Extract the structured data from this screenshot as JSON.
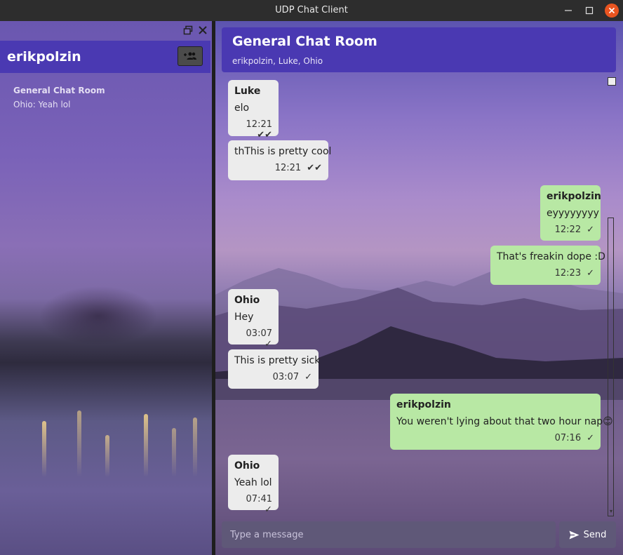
{
  "window": {
    "title": "UDP Chat Client"
  },
  "sidebar": {
    "username": "erikpolzin",
    "conversations": [
      {
        "name": "General Chat Room",
        "preview": "Ohio: Yeah lol"
      }
    ]
  },
  "chat": {
    "room_title": "General Chat Room",
    "members": "erikpolzin, Luke, Ohio",
    "messages": [
      {
        "sender": "Luke",
        "text": "elo",
        "time": "12:21",
        "status": "read",
        "direction": "incoming"
      },
      {
        "sender": "",
        "text": "thThis is pretty cool",
        "time": "12:21",
        "status": "read",
        "direction": "incoming"
      },
      {
        "sender": "erikpolzin",
        "text": "eyyyyyyyy",
        "time": "12:22",
        "status": "sent",
        "direction": "outgoing"
      },
      {
        "sender": "",
        "text": "That's freakin dope :D",
        "time": "12:23",
        "status": "sent",
        "direction": "outgoing"
      },
      {
        "sender": "Ohio",
        "text": "Hey",
        "time": "03:07",
        "status": "sent",
        "direction": "incoming"
      },
      {
        "sender": "",
        "text": "This is pretty sick",
        "time": "03:07",
        "status": "sent",
        "direction": "incoming"
      },
      {
        "sender": "erikpolzin",
        "text": "You weren't lying about that two hour nap😊",
        "time": "07:16",
        "status": "sent",
        "direction": "outgoing"
      },
      {
        "sender": "Ohio",
        "text": "Yeah lol",
        "time": "07:41",
        "status": "sent",
        "direction": "incoming"
      }
    ],
    "composer": {
      "placeholder": "Type a message",
      "value": "",
      "send_label": "Send"
    }
  },
  "colors": {
    "accent": "#4a39b2",
    "incoming_bubble": "#ececec",
    "outgoing_bubble": "#b8e8a4",
    "close_button": "#e95420"
  },
  "icons": {
    "minimize": "minimize-icon",
    "maximize": "maximize-icon",
    "close": "close-icon",
    "restore": "restore-icon",
    "add_group": "add-group-icon",
    "send": "send-icon",
    "read": "double-check-icon",
    "sent": "check-icon"
  }
}
